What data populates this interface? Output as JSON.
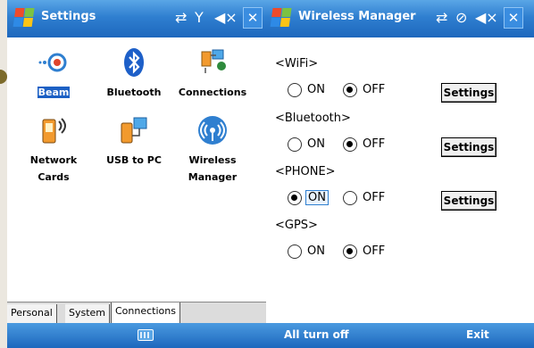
{
  "settings": {
    "title": "Settings",
    "status_icons": [
      "connectivity-icon",
      "antenna-icon",
      "speaker-mute-icon"
    ],
    "items": [
      {
        "label": "Beam",
        "icon": "beam-icon",
        "selected": true
      },
      {
        "label": "Bluetooth",
        "icon": "bluetooth-icon"
      },
      {
        "label": "Connections",
        "icon": "connections-icon"
      },
      {
        "label": "Network\nCards",
        "icon": "network-cards-icon"
      },
      {
        "label": "USB to PC",
        "icon": "usb-to-pc-icon"
      },
      {
        "label": "Wireless\nManager",
        "icon": "wireless-manager-icon"
      }
    ],
    "tabs": [
      "Personal",
      "System",
      "Connections"
    ],
    "active_tab": "Connections",
    "close_glyph": "✕"
  },
  "wireless_manager": {
    "title": "Wireless Manager",
    "sections": [
      {
        "label": "<WiFi>",
        "state": "OFF",
        "has_settings": true
      },
      {
        "label": "<Bluetooth>",
        "state": "OFF",
        "has_settings": true
      },
      {
        "label": "<PHONE>",
        "state": "ON",
        "has_settings": true
      },
      {
        "label": "<GPS>",
        "state": "OFF",
        "has_settings": false
      }
    ],
    "on_label": "ON",
    "off_label": "OFF",
    "settings_label": "Settings",
    "softkeys": {
      "left": "All turn off",
      "right": "Exit"
    },
    "close_glyph": "✕"
  },
  "colors": {
    "titlebar": "#1d67bd",
    "selection": "#1c60c4"
  }
}
